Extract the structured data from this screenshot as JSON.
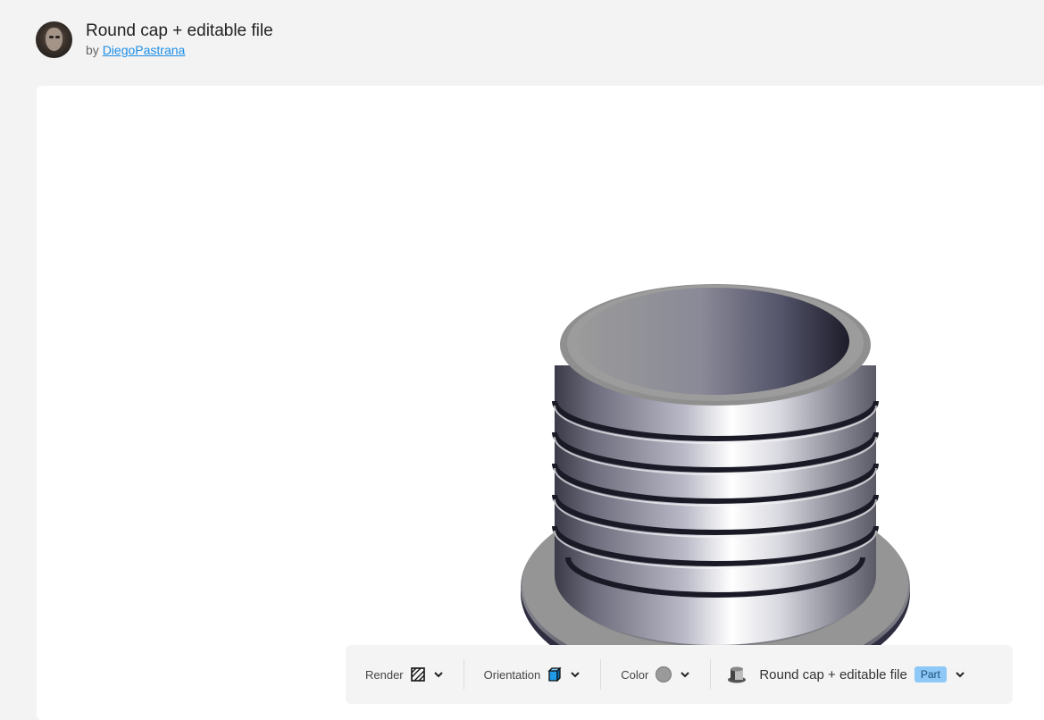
{
  "header": {
    "title": "Round cap + editable file",
    "by_prefix": "by",
    "author": "DiegoPastrana"
  },
  "toolbar": {
    "render_label": "Render",
    "orientation_label": "Orientation",
    "color_label": "Color",
    "part_name": "Round cap + editable file",
    "part_badge": "Part"
  }
}
